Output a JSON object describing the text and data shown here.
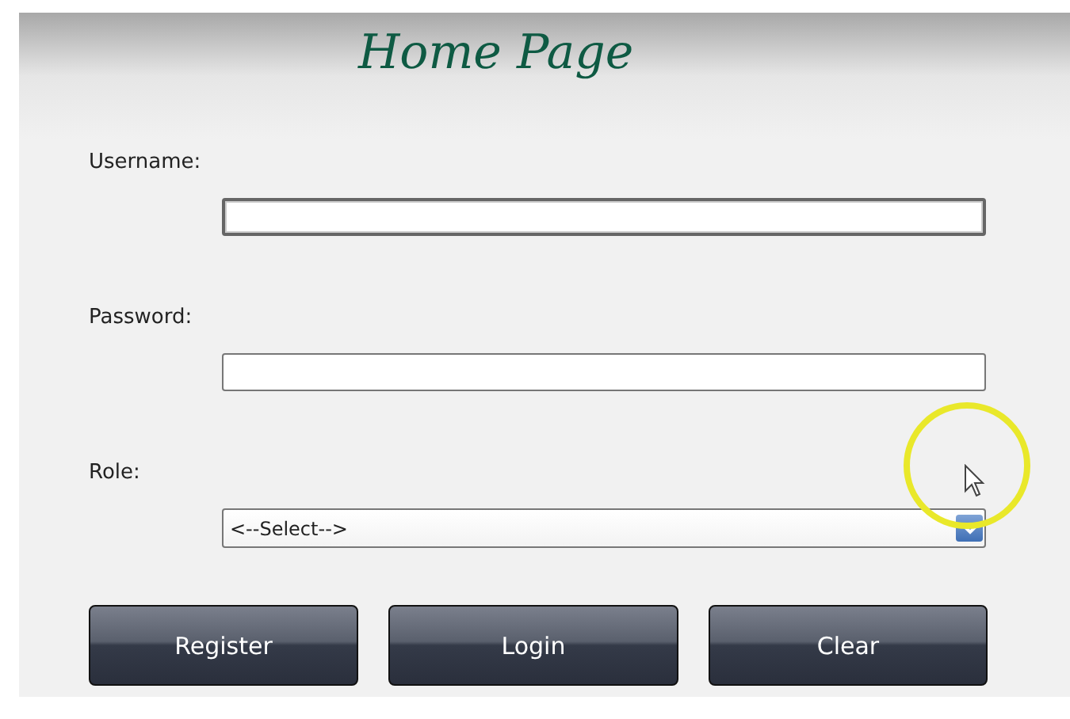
{
  "title": "Home Page",
  "fields": [
    {
      "label": "Username:",
      "kind": "text",
      "focused": true
    },
    {
      "label": "Password:",
      "kind": "password",
      "focused": false
    },
    {
      "label": "Role:",
      "kind": "select",
      "value": "<--Select-->",
      "focused": false
    }
  ],
  "buttons": [
    "Register",
    "Login",
    "Clear"
  ]
}
